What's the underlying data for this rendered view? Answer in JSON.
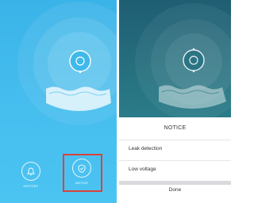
{
  "left_panel": {
    "history_label": "HISTORY",
    "notice_label": "NOTICE"
  },
  "notice_sheet": {
    "title": "NOTICE",
    "items": [
      {
        "label": "Leak detection"
      },
      {
        "label": "Low voltage"
      }
    ],
    "done_label": "Done"
  },
  "colors": {
    "left_background": "#45bdee",
    "right_background": "#26707f",
    "highlight": "#d8443a"
  }
}
